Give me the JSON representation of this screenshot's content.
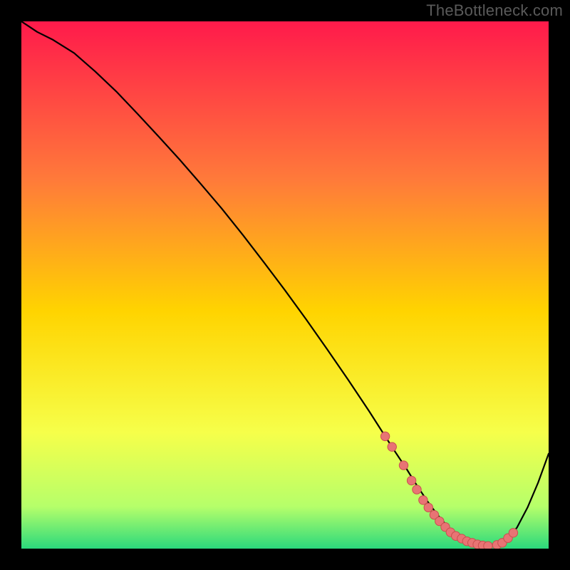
{
  "watermark": "TheBottleneck.com",
  "colors": {
    "bg_black": "#000000",
    "line": "#000000",
    "dot_fill": "#e87474",
    "dot_stroke": "#c94f4f",
    "grad_top": "#ff1a4b",
    "grad_upper_mid": "#ff7a3a",
    "grad_mid": "#ffd400",
    "grad_lower_mid": "#f6ff4a",
    "grad_near_bottom": "#b6ff6a",
    "grad_bottom": "#2bd97c"
  },
  "chart_data": {
    "type": "line",
    "title": "",
    "xlabel": "",
    "ylabel": "",
    "xlim": [
      0,
      100
    ],
    "ylim": [
      0,
      100
    ],
    "grid": false,
    "legend": false,
    "series": [
      {
        "name": "curve",
        "x": [
          0,
          3,
          6,
          10,
          14,
          18,
          22,
          26,
          30,
          34,
          38,
          42,
          46,
          50,
          54,
          58,
          62,
          66,
          69,
          71,
          73,
          75,
          77,
          79,
          81,
          83,
          85,
          87,
          88.5,
          90,
          92,
          94,
          96,
          98,
          100
        ],
        "y": [
          100,
          98,
          96.5,
          94,
          90.5,
          86.7,
          82.5,
          78.2,
          73.8,
          69.2,
          64.5,
          59.5,
          54.3,
          49.0,
          43.5,
          37.8,
          32.0,
          26.0,
          21.3,
          18.2,
          15.2,
          12.0,
          9.0,
          6.3,
          4.0,
          2.3,
          1.2,
          0.6,
          0.5,
          0.6,
          1.6,
          4.0,
          7.8,
          12.5,
          18.0
        ]
      }
    ],
    "markers": {
      "name": "dots",
      "x": [
        69.0,
        70.3,
        72.5,
        74.0,
        75.0,
        76.2,
        77.2,
        78.3,
        79.3,
        80.4,
        81.4,
        82.4,
        83.5,
        84.5,
        85.5,
        86.5,
        87.5,
        88.5,
        90.2,
        91.2,
        92.3,
        93.3
      ],
      "y": [
        21.3,
        19.3,
        15.8,
        12.9,
        11.2,
        9.2,
        7.8,
        6.4,
        5.2,
        4.1,
        3.1,
        2.4,
        1.9,
        1.4,
        1.1,
        0.8,
        0.6,
        0.5,
        0.7,
        1.1,
        2.0,
        3.0
      ]
    }
  }
}
